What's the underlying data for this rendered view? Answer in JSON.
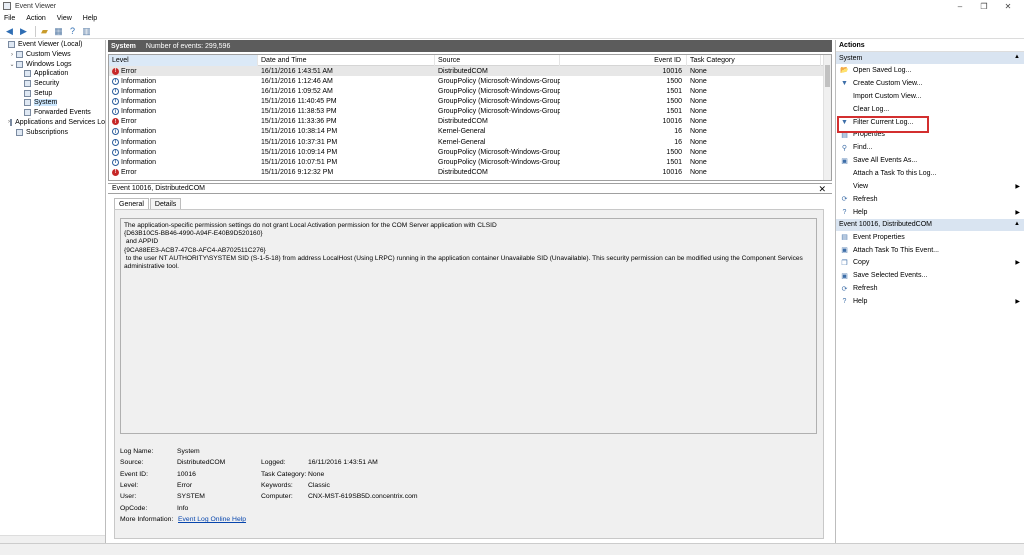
{
  "window": {
    "title": "Event Viewer",
    "controls": [
      "–",
      "❐",
      "✕"
    ]
  },
  "menu": [
    "File",
    "Action",
    "View",
    "Help"
  ],
  "toolbar": {
    "icons": [
      "back-arrow-icon",
      "forward-arrow-icon",
      "folder-up-icon",
      "show-hide-tree-icon",
      "help-icon",
      "show-action-pane-icon"
    ]
  },
  "tree": {
    "items": [
      {
        "label": "Event Viewer (Local)",
        "indent": 0,
        "exp": "",
        "selected": false
      },
      {
        "label": "Custom Views",
        "indent": 1,
        "exp": "›",
        "selected": false
      },
      {
        "label": "Windows Logs",
        "indent": 1,
        "exp": "⌄",
        "selected": false
      },
      {
        "label": "Application",
        "indent": 2,
        "exp": "",
        "selected": false
      },
      {
        "label": "Security",
        "indent": 2,
        "exp": "",
        "selected": false
      },
      {
        "label": "Setup",
        "indent": 2,
        "exp": "",
        "selected": false
      },
      {
        "label": "System",
        "indent": 2,
        "exp": "",
        "selected": true
      },
      {
        "label": "Forwarded Events",
        "indent": 2,
        "exp": "",
        "selected": false
      },
      {
        "label": "Applications and Services Lo",
        "indent": 1,
        "exp": "›",
        "selected": false
      },
      {
        "label": "Subscriptions",
        "indent": 1,
        "exp": "",
        "selected": false
      }
    ]
  },
  "center": {
    "log_name": "System",
    "event_count": "Number of events: 299,596",
    "columns": {
      "level": "Level",
      "date": "Date and Time",
      "source": "Source",
      "event_id": "Event ID",
      "task": "Task Category"
    },
    "rows": [
      {
        "level": "Error",
        "date": "16/11/2016 1:43:51 AM",
        "source": "DistributedCOM",
        "event_id": "10016",
        "task": "None"
      },
      {
        "level": "Information",
        "date": "16/11/2016 1:12:46 AM",
        "source": "GroupPolicy (Microsoft-Windows-Group...",
        "event_id": "1500",
        "task": "None"
      },
      {
        "level": "Information",
        "date": "16/11/2016 1:09:52 AM",
        "source": "GroupPolicy (Microsoft-Windows-Group...",
        "event_id": "1501",
        "task": "None"
      },
      {
        "level": "Information",
        "date": "15/11/2016 11:40:45 PM",
        "source": "GroupPolicy (Microsoft-Windows-Group...",
        "event_id": "1500",
        "task": "None"
      },
      {
        "level": "Information",
        "date": "15/11/2016 11:38:53 PM",
        "source": "GroupPolicy (Microsoft-Windows-Group...",
        "event_id": "1501",
        "task": "None"
      },
      {
        "level": "Error",
        "date": "15/11/2016 11:33:36 PM",
        "source": "DistributedCOM",
        "event_id": "10016",
        "task": "None"
      },
      {
        "level": "Information",
        "date": "15/11/2016 10:38:14 PM",
        "source": "Kernel-General",
        "event_id": "16",
        "task": "None"
      },
      {
        "level": "Information",
        "date": "15/11/2016 10:37:31 PM",
        "source": "Kernel-General",
        "event_id": "16",
        "task": "None"
      },
      {
        "level": "Information",
        "date": "15/11/2016 10:09:14 PM",
        "source": "GroupPolicy (Microsoft-Windows-Group...",
        "event_id": "1500",
        "task": "None"
      },
      {
        "level": "Information",
        "date": "15/11/2016 10:07:51 PM",
        "source": "GroupPolicy (Microsoft-Windows-Group...",
        "event_id": "1501",
        "task": "None"
      },
      {
        "level": "Error",
        "date": "15/11/2016 9:12:32 PM",
        "source": "DistributedCOM",
        "event_id": "10016",
        "task": "None"
      }
    ]
  },
  "detail": {
    "title": "Event 10016, DistributedCOM",
    "tabs": [
      "General",
      "Details"
    ],
    "message_lines": [
      "The application-specific permission settings do not grant Local Activation permission for the COM Server application with CLSID",
      "{D63B10C5-BB46-4990-A94F-E40B9D520160}",
      " and APPID",
      "{9CA88EE3-ACB7-47C8-AFC4-AB702511C276}",
      " to the user NT AUTHORITY\\SYSTEM SID (S-1-5-18) from address LocalHost (Using LRPC) running in the application container Unavailable SID (Unavailable). This security permission can be modified using the Component Services",
      "administrative tool."
    ],
    "props": {
      "log_name_label": "Log Name:",
      "log_name": "System",
      "source_label": "Source:",
      "source": "DistributedCOM",
      "logged_label": "Logged:",
      "logged": "16/11/2016 1:43:51 AM",
      "event_id_label": "Event ID:",
      "event_id": "10016",
      "task_label": "Task Category:",
      "task": "None",
      "level_label": "Level:",
      "level": "Error",
      "keywords_label": "Keywords:",
      "keywords": "Classic",
      "user_label": "User:",
      "user": "SYSTEM",
      "computer_label": "Computer:",
      "computer": "CNX-MST-619SB5D.concentrix.com",
      "opcode_label": "OpCode:",
      "opcode": "Info",
      "more_info_label": "More Information:",
      "more_info_link": "Event Log Online Help"
    }
  },
  "actions": {
    "title": "Actions",
    "section1": "System",
    "items1": [
      {
        "label": "Open Saved Log...",
        "icon": "folder-open-icon",
        "glyph": "📂",
        "arrow": false
      },
      {
        "label": "Create Custom View...",
        "icon": "filter-create-icon",
        "glyph": "▼",
        "arrow": false
      },
      {
        "label": "Import Custom View...",
        "icon": "import-icon",
        "glyph": "",
        "arrow": false
      },
      {
        "label": "Clear Log...",
        "icon": "clear-icon",
        "glyph": "",
        "arrow": false
      },
      {
        "label": "Filter Current Log...",
        "icon": "filter-icon",
        "glyph": "▼",
        "arrow": false
      },
      {
        "label": "Properties",
        "icon": "properties-icon",
        "glyph": "▤",
        "arrow": false
      },
      {
        "label": "Find...",
        "icon": "find-icon",
        "glyph": "⚲",
        "arrow": false
      },
      {
        "label": "Save All Events As...",
        "icon": "save-icon",
        "glyph": "▣",
        "arrow": false
      },
      {
        "label": "Attach a Task To this Log...",
        "icon": "attach-task-icon",
        "glyph": "",
        "arrow": false
      },
      {
        "label": "View",
        "icon": "view-icon",
        "glyph": "",
        "arrow": true
      },
      {
        "label": "Refresh",
        "icon": "refresh-icon",
        "glyph": "⟳",
        "arrow": false
      },
      {
        "label": "Help",
        "icon": "help-icon",
        "glyph": "?",
        "arrow": true
      }
    ],
    "section2": "Event 10016, DistributedCOM",
    "items2": [
      {
        "label": "Event Properties",
        "icon": "event-properties-icon",
        "glyph": "▤",
        "arrow": false
      },
      {
        "label": "Attach Task To This Event...",
        "icon": "attach-event-task-icon",
        "glyph": "▣",
        "arrow": false
      },
      {
        "label": "Copy",
        "icon": "copy-icon",
        "glyph": "❐",
        "arrow": true
      },
      {
        "label": "Save Selected Events...",
        "icon": "save-selected-icon",
        "glyph": "▣",
        "arrow": false
      },
      {
        "label": "Refresh",
        "icon": "refresh-icon",
        "glyph": "⟳",
        "arrow": false
      },
      {
        "label": "Help",
        "icon": "help-icon",
        "glyph": "?",
        "arrow": true
      }
    ]
  },
  "colors": {
    "header_dark": "#5c5c5c",
    "action_section": "#d9e4f1",
    "highlight_border": "#d32f2f",
    "error_icon": "#c62828",
    "info_icon": "#2b5d9b",
    "link": "#0645ad"
  }
}
